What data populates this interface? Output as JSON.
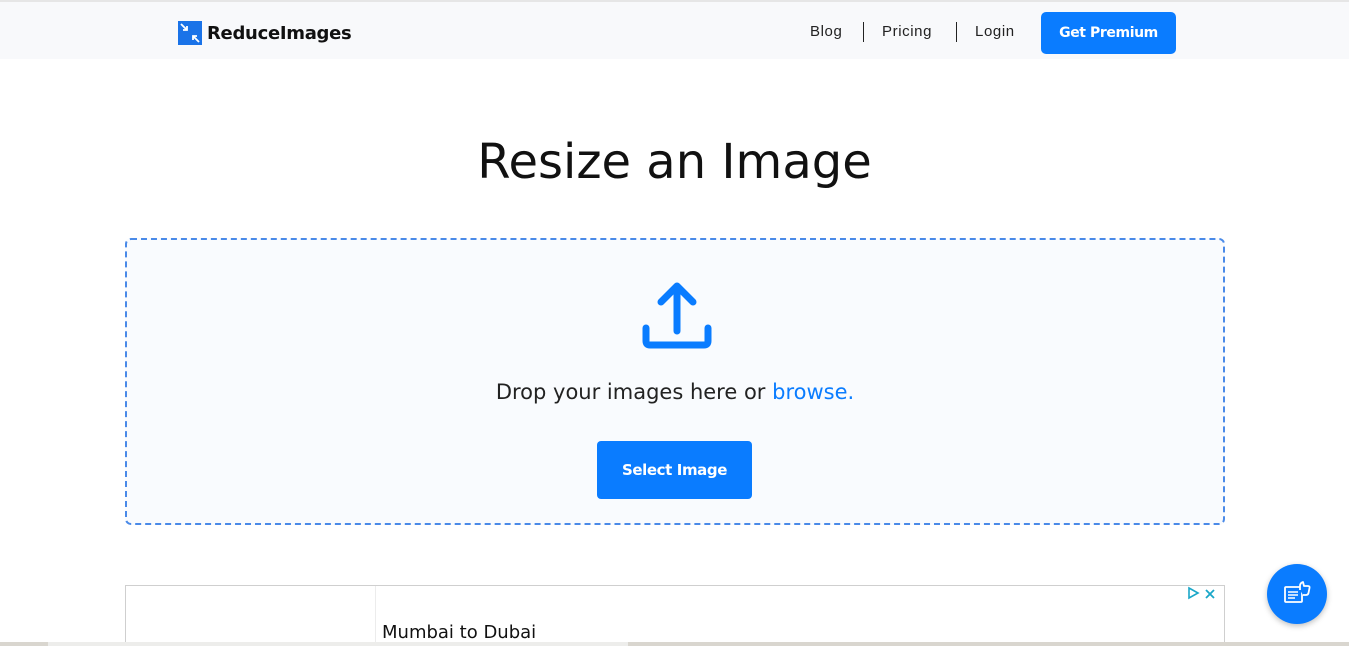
{
  "header": {
    "brand": "ReduceImages",
    "nav": [
      {
        "label": "Blog"
      },
      {
        "label": "Pricing"
      },
      {
        "label": "Login"
      }
    ],
    "premium_label": "Get Premium"
  },
  "main": {
    "title": "Resize an Image",
    "drop_text": "Drop your images here or ",
    "browse_label": "browse.",
    "select_label": "Select Image"
  },
  "ad": {
    "title": "Mumbai to Dubai",
    "choices_icon": "ad-choices-icon",
    "close_icon": "close-icon"
  },
  "feedback": {
    "icon": "feedback-icon"
  },
  "colors": {
    "accent": "#0a7cff",
    "dropzone_border": "#4a8ae8"
  }
}
